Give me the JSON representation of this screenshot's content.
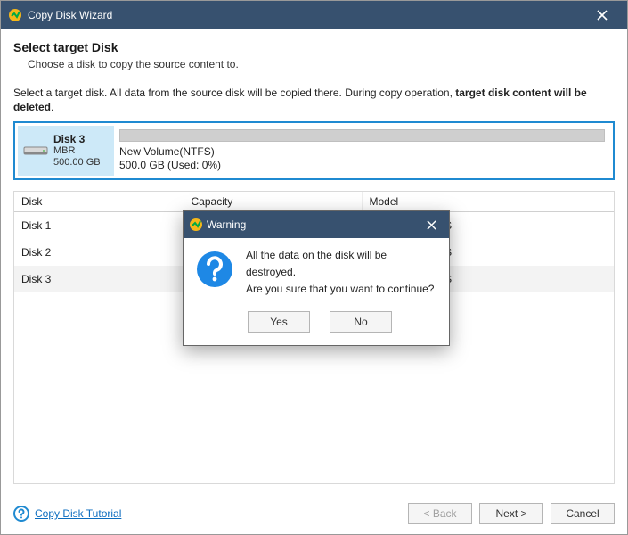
{
  "titlebar": {
    "title": "Copy Disk Wizard"
  },
  "page": {
    "heading": "Select target Disk",
    "subheading": "Choose a disk to copy the source content to.",
    "instruction_prefix": "Select a target disk. All data from the source disk will be copied there. During copy operation, ",
    "instruction_bold": "target disk content will be deleted",
    "instruction_suffix": "."
  },
  "target": {
    "name": "Disk 3",
    "scheme": "MBR",
    "size": "500.00 GB",
    "volume": "New Volume(NTFS)",
    "volume_detail": "500.0 GB (Used: 0%)"
  },
  "table": {
    "cols": {
      "disk": "Disk",
      "capacity": "Capacity",
      "model": "Model"
    },
    "rows": [
      {
        "disk": "Disk 1",
        "capacity": "",
        "model": "are Virtual S SAS"
      },
      {
        "disk": "Disk 2",
        "capacity": "",
        "model": "are Virtual S SAS"
      },
      {
        "disk": "Disk 3",
        "capacity": "",
        "model": "are Virtual S SAS"
      }
    ]
  },
  "footer": {
    "tutorial": "Copy Disk Tutorial",
    "back": "< Back",
    "next": "Next >",
    "cancel": "Cancel"
  },
  "dialog": {
    "title": "Warning",
    "line1": "All the data on the disk will be destroyed.",
    "line2": "Are you sure that you want to continue?",
    "yes": "Yes",
    "no": "No"
  },
  "colors": {
    "titlebar": "#37516f",
    "accent": "#1f8ad1",
    "selected_bg": "#cde9f8",
    "dialog_icon_bg": "#1e88e5"
  }
}
